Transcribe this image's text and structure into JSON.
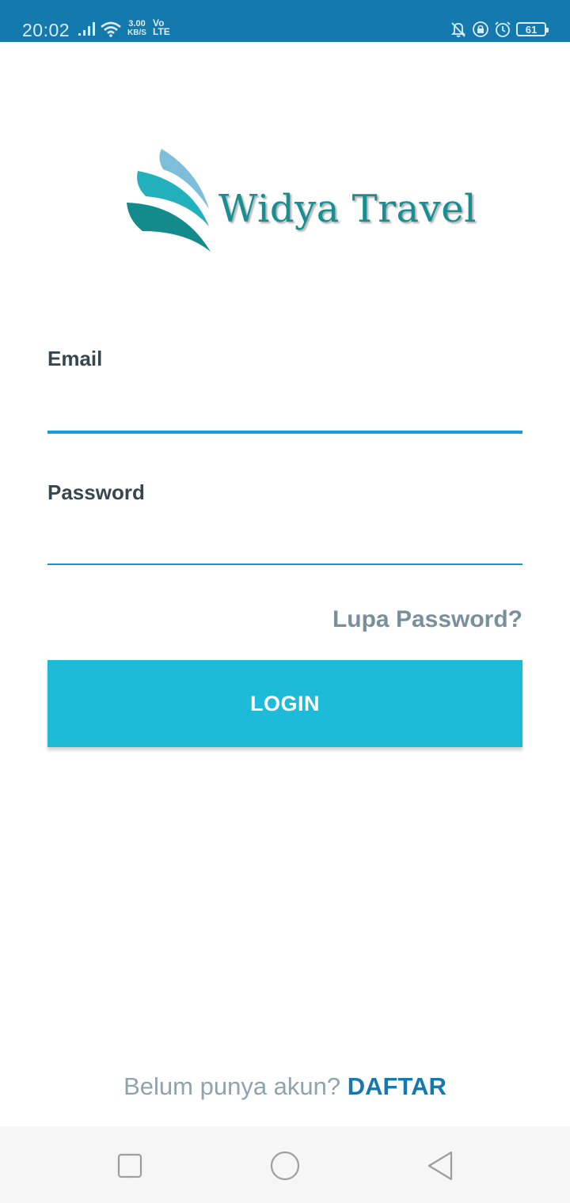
{
  "status_bar": {
    "time": "20:02",
    "net_speed_value": "3.00",
    "net_speed_unit": "KB/S",
    "volte_top": "Vo",
    "volte_bottom": "LTE",
    "battery": "61",
    "icons": [
      "signal-icon",
      "wifi-icon",
      "bell-off-icon",
      "rotation-lock-icon",
      "alarm-icon",
      "battery-icon"
    ],
    "bg_color": "#1479ad"
  },
  "logo": {
    "text": "Widya Travel",
    "color": "#178f92"
  },
  "form": {
    "email_label": "Email",
    "email_value": "",
    "password_label": "Password",
    "password_value": "",
    "forgot_password": "Lupa Password?",
    "login_button": "LOGIN",
    "accent_color": "#1ebbd8"
  },
  "register": {
    "question": "Belum punya akun?",
    "link": "DAFTAR"
  },
  "nav_bar": {
    "buttons": [
      "recent-apps-icon",
      "home-icon",
      "back-icon"
    ]
  }
}
